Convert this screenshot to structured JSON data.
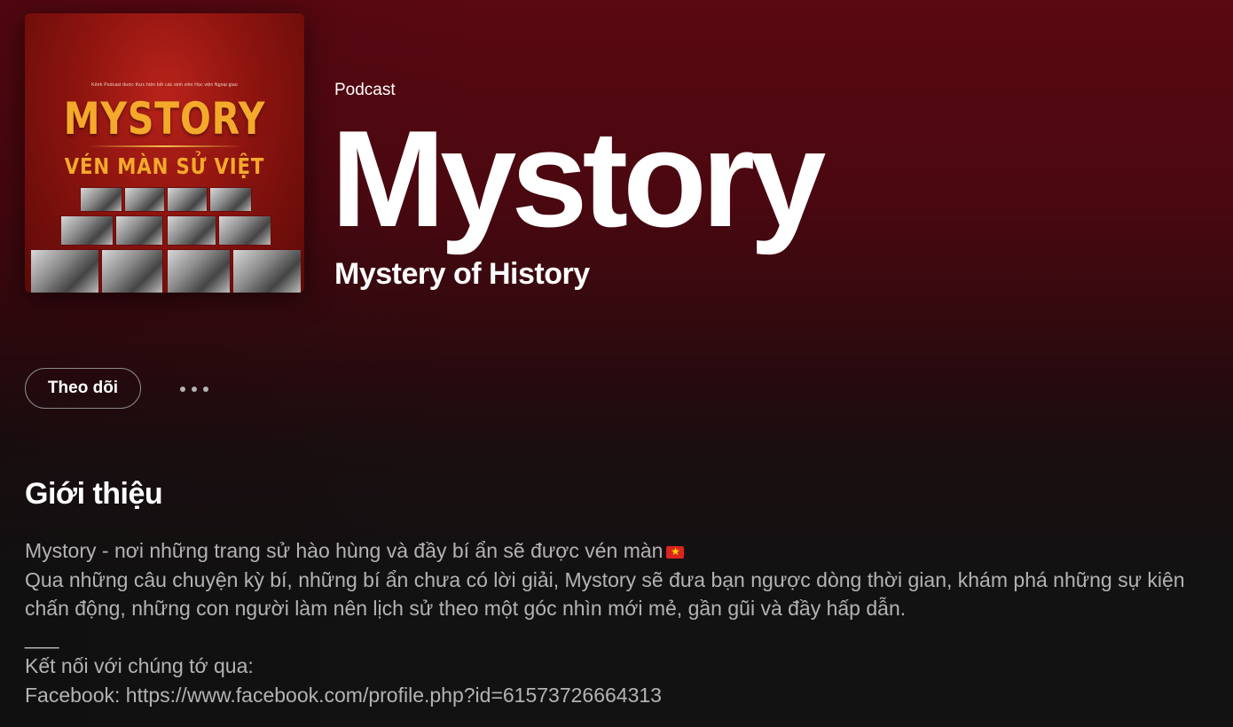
{
  "header": {
    "type_label": "Podcast",
    "title": "Mystory",
    "author": "Mystery of History"
  },
  "cover": {
    "top_text": "Kênh Podcast được thực hiện bởi các sinh viên Học viện Ngoại giao",
    "title": "MYSTORY",
    "subtitle": "VÉN MÀN SỬ VIỆT",
    "accent_color": "#f4a92b",
    "background_color": "#8d140f"
  },
  "actions": {
    "follow_label": "Theo dõi",
    "more_icon": "more-options-icon"
  },
  "about": {
    "heading": "Giới thiệu",
    "lines": [
      "Mystory - nơi những trang sử hào hùng và đầy bí ẩn sẽ được vén màn",
      "Qua những câu chuyện kỳ bí, những bí ẩn chưa có lời giải, Mystory sẽ đưa bạn ngược dòng thời gian, khám phá những sự kiện",
      "chấn động, những con người làm nên lịch sử theo một góc nhìn mới mẻ, gần gũi và đầy hấp dẫn.",
      "___",
      "Kết nối với chúng tớ qua:",
      "Facebook: https://www.facebook.com/profile.php?id=61573726664313"
    ],
    "flag_icon": "vietnam-flag-icon"
  },
  "colors": {
    "hero_top": "#5a0811",
    "page_background": "#121212",
    "text_primary": "#ffffff",
    "text_secondary": "#b3b3b3"
  }
}
